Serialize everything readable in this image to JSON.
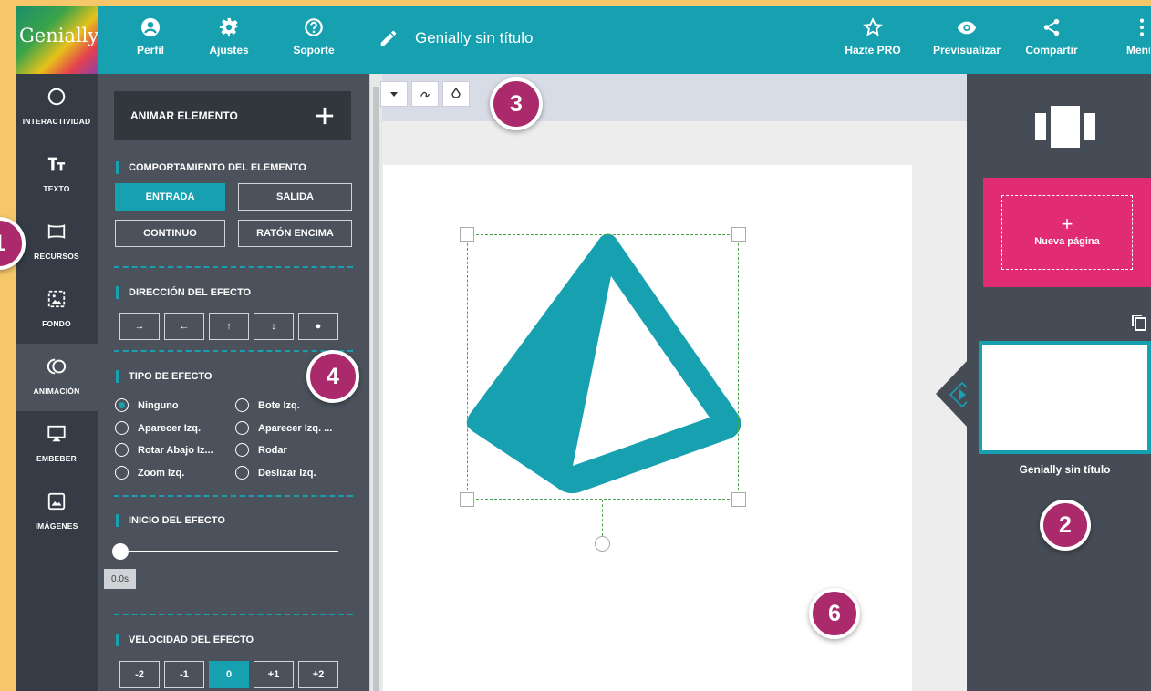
{
  "app": {
    "logo_text": "Genially",
    "document_title": "Genially sin título",
    "accent_color": "#16a0b0",
    "accent_pink": "#e12c73"
  },
  "header": {
    "left_buttons": [
      {
        "label": "Perfil",
        "icon": "user-icon"
      },
      {
        "label": "Ajustes",
        "icon": "gear-icon"
      },
      {
        "label": "Soporte",
        "icon": "help-icon"
      }
    ],
    "right_buttons": [
      {
        "label": "Hazte PRO",
        "icon": "star-icon"
      },
      {
        "label": "Previsualizar",
        "icon": "eye-icon"
      },
      {
        "label": "Compartir",
        "icon": "share-icon"
      },
      {
        "label": "Menu",
        "icon": "more-icon"
      }
    ]
  },
  "sidebar": {
    "items": [
      {
        "label": "INTERACTIVIDAD",
        "icon": "circle-icon"
      },
      {
        "label": "TEXTO",
        "icon": "text-icon"
      },
      {
        "label": "RECURSOS",
        "icon": "resources-icon"
      },
      {
        "label": "FONDO",
        "icon": "background-icon"
      },
      {
        "label": "ANIMACIÓN",
        "icon": "animation-icon"
      },
      {
        "label": "EMBEBER",
        "icon": "embed-icon"
      },
      {
        "label": "IMÁGENES",
        "icon": "image-icon"
      }
    ],
    "active": "ANIMACIÓN"
  },
  "panel": {
    "animate_label": "ANIMAR ELEMENTO",
    "behavior_title": "COMPORTAMIENTO DEL ELEMENTO",
    "behavior_buttons": [
      "ENTRADA",
      "SALIDA",
      "CONTINUO",
      "RATÓN ENCIMA"
    ],
    "behavior_selected": "ENTRADA",
    "direction_title": "DIRECCIÓN DEL EFECTO",
    "direction_buttons": [
      "→",
      "←",
      "↑",
      "↓",
      "●"
    ],
    "effect_title": "TIPO DE EFECTO",
    "effects": [
      "Ninguno",
      "Bote Izq.",
      "Aparecer Izq.",
      "Aparecer Izq. ...",
      "Rotar Abajo Iz...",
      "Rodar",
      "Zoom Izq.",
      "Deslizar Izq."
    ],
    "effect_selected": "Ninguno",
    "start_title": "INICIO DEL EFECTO",
    "start_value": "0.0s",
    "speed_title": "VELOCIDAD DEL EFECTO",
    "speed_buttons": [
      "-2",
      "-1",
      "0",
      "+1",
      "+2"
    ],
    "speed_selected": "0"
  },
  "right_panel": {
    "new_page_label": "Nueva página",
    "new_page_plus": "+",
    "page_title": "Genially sin título"
  },
  "badges": [
    "1",
    "2",
    "3",
    "4",
    "6"
  ]
}
